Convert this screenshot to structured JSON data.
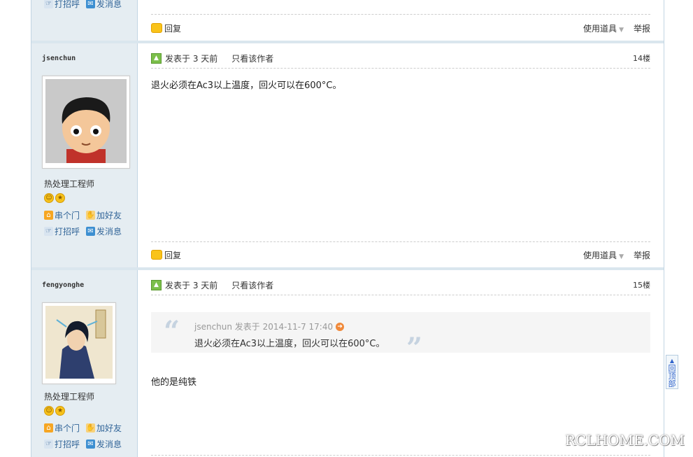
{
  "prev_post": {
    "side_links": [
      {
        "icon": "poke-icon",
        "label": "打招呼"
      },
      {
        "icon": "mail-icon",
        "label": "发消息"
      }
    ],
    "footer": {
      "reply": "回复",
      "tools": "使用道具",
      "report": "举报"
    }
  },
  "posts": [
    {
      "username": "jsenchun",
      "rank": "热处理工程师",
      "links": [
        {
          "icon": "home-icon",
          "label": "串个门"
        },
        {
          "icon": "handshake-icon",
          "label": "加好友"
        },
        {
          "icon": "poke-icon",
          "label": "打招呼"
        },
        {
          "icon": "mail-icon",
          "label": "发消息"
        }
      ],
      "posted": "发表于 3 天前",
      "only_author": "只看该作者",
      "floor": "14楼",
      "content": "退火必须在Ac3以上温度，回火可以在600°C。",
      "footer": {
        "reply": "回复",
        "tools": "使用道具",
        "report": "举报"
      }
    },
    {
      "username": "fengyonghe",
      "rank": "热处理工程师",
      "links": [
        {
          "icon": "home-icon",
          "label": "串个门"
        },
        {
          "icon": "handshake-icon",
          "label": "加好友"
        },
        {
          "icon": "poke-icon",
          "label": "打招呼"
        },
        {
          "icon": "mail-icon",
          "label": "发消息"
        }
      ],
      "posted": "发表于 3 天前",
      "only_author": "只看该作者",
      "floor": "15楼",
      "quote": {
        "head": "jsenchun 发表于 2014-11-7 17:40",
        "body": "退火必须在Ac3以上温度，回火可以在600°C。"
      },
      "content": "他的是纯铁"
    }
  ],
  "back_to_top": "回顶部",
  "watermark": "RCLHOME.COM",
  "colors": {
    "border": "#c2d5e3",
    "sidebar": "#e5edf2",
    "link": "#336699"
  }
}
